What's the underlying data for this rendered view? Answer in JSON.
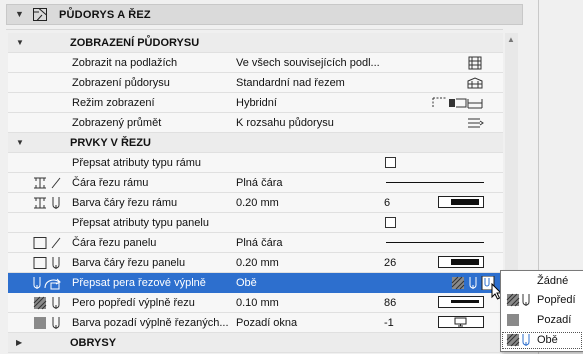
{
  "section": {
    "title": "PŮDORYS A ŘEZ"
  },
  "groups": {
    "floor_plan": "ZOBRAZENÍ PŮDORYSU",
    "cut": "PRVKY V ŘEZU",
    "outlines": "OBRYSY"
  },
  "floor_rows": [
    {
      "label": "Zobrazit na podlažích",
      "value": "Ve všech souvisejících podl...",
      "icon": "stories-icon"
    },
    {
      "label": "Zobrazení půdorysu",
      "value": "Standardní nad řezem",
      "icon": "floor-plan-display-icon"
    },
    {
      "label": "Režim zobrazení",
      "value": "Hybridní",
      "icon": "display-mode-icon"
    },
    {
      "label": "Zobrazený průmět",
      "value": "K rozsahu půdorysu",
      "icon": "projection-icon"
    }
  ],
  "cut_rows": [
    {
      "label": "Přepsat atributy typu rámu",
      "value": "",
      "num": "",
      "checkbox": true
    },
    {
      "label": "Čára řezu rámu",
      "value": "Plná čára",
      "num": "",
      "line": true
    },
    {
      "label": "Barva čáry řezu rámu",
      "value": "0.20 mm",
      "num": "6"
    },
    {
      "label": "Přepsat atributy typu panelu",
      "value": "",
      "num": "",
      "checkbox": true
    },
    {
      "label": "Čára řezu panelu",
      "value": "Plná čára",
      "num": "",
      "line": true
    },
    {
      "label": "Barva čáry řezu panelu",
      "value": "0.20 mm",
      "num": "26"
    },
    {
      "label": "Přepsat pera řezové výplně",
      "value": "Obě",
      "num": ""
    },
    {
      "label": "Pero popředí výplně řezu",
      "value": "0.10 mm",
      "num": "86"
    },
    {
      "label": "Barva pozadí výplně řezaných...",
      "value": "Pozadí okna",
      "num": "-1"
    }
  ],
  "popup_options": [
    {
      "label": "Žádné"
    },
    {
      "label": "Popředí"
    },
    {
      "label": "Pozadí"
    },
    {
      "label": "Obě"
    }
  ],
  "colors": {
    "selection": "#2d6fce",
    "header_bg": "#dadada"
  }
}
